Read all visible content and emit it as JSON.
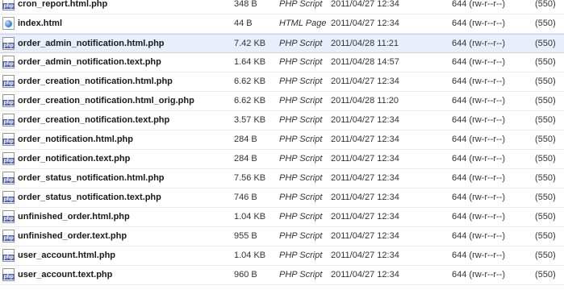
{
  "files": [
    {
      "icon": "php-file-icon",
      "icon_text": "php",
      "name": "cron_report.html.php",
      "size": "348 B",
      "type": "PHP Script",
      "modified": "2011/04/27 12:34",
      "permissions": "644 (rw-r--r--)",
      "owner": "(550)",
      "selected": false
    },
    {
      "icon": "html-file-icon",
      "icon_text": "",
      "name": "index.html",
      "size": "44 B",
      "type": "HTML Page",
      "modified": "2011/04/27 12:34",
      "permissions": "644 (rw-r--r--)",
      "owner": "(550)",
      "selected": false
    },
    {
      "icon": "php-file-icon",
      "icon_text": "php",
      "name": "order_admin_notification.html.php",
      "size": "7.42 KB",
      "type": "PHP Script",
      "modified": "2011/04/28 11:21",
      "permissions": "644 (rw-r--r--)",
      "owner": "(550)",
      "selected": true
    },
    {
      "icon": "php-file-icon",
      "icon_text": "php",
      "name": "order_admin_notification.text.php",
      "size": "1.64 KB",
      "type": "PHP Script",
      "modified": "2011/04/28 14:57",
      "permissions": "644 (rw-r--r--)",
      "owner": "(550)",
      "selected": false
    },
    {
      "icon": "php-file-icon",
      "icon_text": "php",
      "name": "order_creation_notification.html.php",
      "size": "6.62 KB",
      "type": "PHP Script",
      "modified": "2011/04/27 12:34",
      "permissions": "644 (rw-r--r--)",
      "owner": "(550)",
      "selected": false
    },
    {
      "icon": "php-file-icon",
      "icon_text": "php",
      "name": "order_creation_notification.html_orig.php",
      "size": "6.62 KB",
      "type": "PHP Script",
      "modified": "2011/04/28 11:20",
      "permissions": "644 (rw-r--r--)",
      "owner": "(550)",
      "selected": false
    },
    {
      "icon": "php-file-icon",
      "icon_text": "php",
      "name": "order_creation_notification.text.php",
      "size": "3.57 KB",
      "type": "PHP Script",
      "modified": "2011/04/27 12:34",
      "permissions": "644 (rw-r--r--)",
      "owner": "(550)",
      "selected": false
    },
    {
      "icon": "php-file-icon",
      "icon_text": "php",
      "name": "order_notification.html.php",
      "size": "284 B",
      "type": "PHP Script",
      "modified": "2011/04/27 12:34",
      "permissions": "644 (rw-r--r--)",
      "owner": "(550)",
      "selected": false
    },
    {
      "icon": "php-file-icon",
      "icon_text": "php",
      "name": "order_notification.text.php",
      "size": "284 B",
      "type": "PHP Script",
      "modified": "2011/04/27 12:34",
      "permissions": "644 (rw-r--r--)",
      "owner": "(550)",
      "selected": false
    },
    {
      "icon": "php-file-icon",
      "icon_text": "php",
      "name": "order_status_notification.html.php",
      "size": "7.56 KB",
      "type": "PHP Script",
      "modified": "2011/04/27 12:34",
      "permissions": "644 (rw-r--r--)",
      "owner": "(550)",
      "selected": false
    },
    {
      "icon": "php-file-icon",
      "icon_text": "php",
      "name": "order_status_notification.text.php",
      "size": "746 B",
      "type": "PHP Script",
      "modified": "2011/04/27 12:34",
      "permissions": "644 (rw-r--r--)",
      "owner": "(550)",
      "selected": false
    },
    {
      "icon": "php-file-icon",
      "icon_text": "php",
      "name": "unfinished_order.html.php",
      "size": "1.04 KB",
      "type": "PHP Script",
      "modified": "2011/04/27 12:34",
      "permissions": "644 (rw-r--r--)",
      "owner": "(550)",
      "selected": false
    },
    {
      "icon": "php-file-icon",
      "icon_text": "php",
      "name": "unfinished_order.text.php",
      "size": "955 B",
      "type": "PHP Script",
      "modified": "2011/04/27 12:34",
      "permissions": "644 (rw-r--r--)",
      "owner": "(550)",
      "selected": false
    },
    {
      "icon": "php-file-icon",
      "icon_text": "php",
      "name": "user_account.html.php",
      "size": "1.04 KB",
      "type": "PHP Script",
      "modified": "2011/04/27 12:34",
      "permissions": "644 (rw-r--r--)",
      "owner": "(550)",
      "selected": false
    },
    {
      "icon": "php-file-icon",
      "icon_text": "php",
      "name": "user_account.text.php",
      "size": "960 B",
      "type": "PHP Script",
      "modified": "2011/04/27 12:34",
      "permissions": "644 (rw-r--r--)",
      "owner": "(550)",
      "selected": false
    }
  ],
  "colors": {
    "selected_row": "#e8eefa",
    "row_border": "#e9e9e9",
    "php_icon_band": "#5a64a8"
  }
}
